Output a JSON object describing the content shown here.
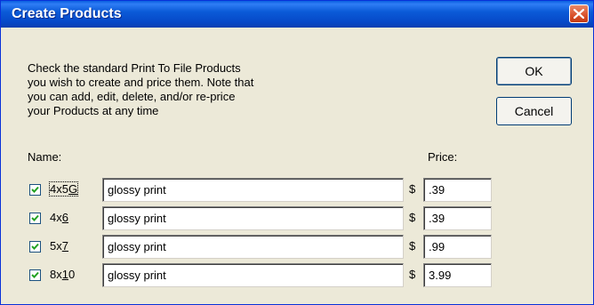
{
  "window": {
    "title": "Create Products"
  },
  "description": {
    "lines": [
      "Check the standard Print To File Products",
      "you wish to create and price them.  Note that",
      "you can add, edit, delete, and/or re-price",
      "your Products at any time"
    ]
  },
  "buttons": {
    "ok_label": "OK",
    "cancel_label": "Cancel"
  },
  "columns": {
    "name_label": "Name:",
    "price_label": "Price:"
  },
  "currency_symbol": "$",
  "products": [
    {
      "checked": true,
      "size_before": "4x5",
      "size_key": "G",
      "size_after": "",
      "description": "glossy print",
      "price": ".39",
      "focused": true
    },
    {
      "checked": true,
      "size_before": "4x",
      "size_key": "6",
      "size_after": "",
      "description": "glossy print",
      "price": ".39",
      "focused": false
    },
    {
      "checked": true,
      "size_before": "5x",
      "size_key": "7",
      "size_after": "",
      "description": "glossy print",
      "price": ".99",
      "focused": false
    },
    {
      "checked": true,
      "size_before": "8x",
      "size_key": "1",
      "size_after": "0",
      "description": "glossy print",
      "price": "3.99",
      "focused": false
    }
  ]
}
